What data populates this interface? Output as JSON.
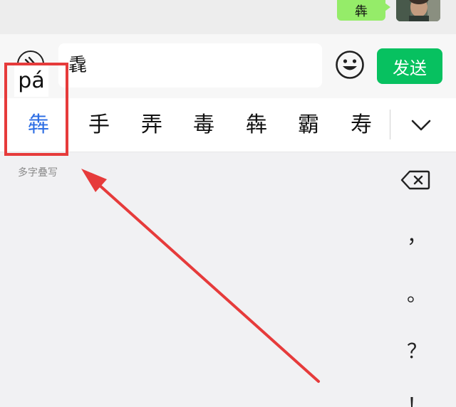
{
  "chat": {
    "bubble_text": "犇"
  },
  "input_bar": {
    "input_value": "毳",
    "pinyin": "pá",
    "send_label": "发送",
    "voice_icon": "voice-icon",
    "emoji_icon": "emoji-icon"
  },
  "candidates": {
    "items": [
      "犇",
      "手",
      "弄",
      "毒",
      "犇",
      "霸",
      "寿"
    ],
    "selected_index": 0,
    "expand_icon": "chevron-down-icon"
  },
  "keyboard": {
    "mode_label": "多字叠写",
    "backspace_icon": "backspace-icon",
    "punctuation": [
      "，",
      "。",
      "？",
      "！"
    ]
  },
  "colors": {
    "send_green": "#07c160",
    "bubble_green": "#95ec69",
    "selected_blue": "#2f6fe4",
    "annotation_red": "#e63b3b"
  }
}
